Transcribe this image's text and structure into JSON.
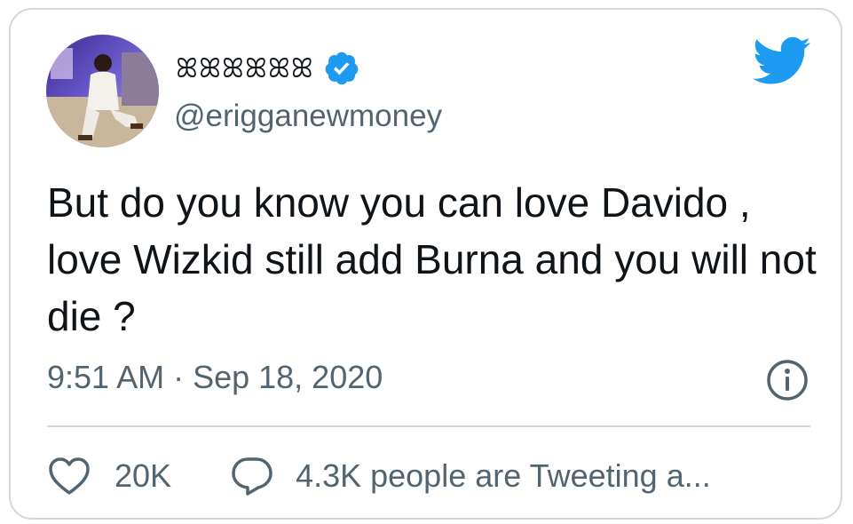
{
  "tweet": {
    "display_name": "ꕤꕤꕤꕤꕤꕤ",
    "handle": "@erigganewmoney",
    "text": "But do you know you can love Davido , love Wizkid still add Burna and you will not die ?",
    "timestamp": "9:51 AM · Sep 18, 2020",
    "likes": "20K",
    "reply_text": "4.3K people are Tweeting a..."
  },
  "icons": {
    "verified": "verified-badge-icon",
    "brand": "twitter-bird-icon",
    "info": "info-icon",
    "like": "heart-icon",
    "reply": "speech-bubble-icon"
  },
  "colors": {
    "brand_blue": "#1d9bf0",
    "text_primary": "#0f1419",
    "text_secondary": "#536471",
    "border": "#cfd9de"
  }
}
